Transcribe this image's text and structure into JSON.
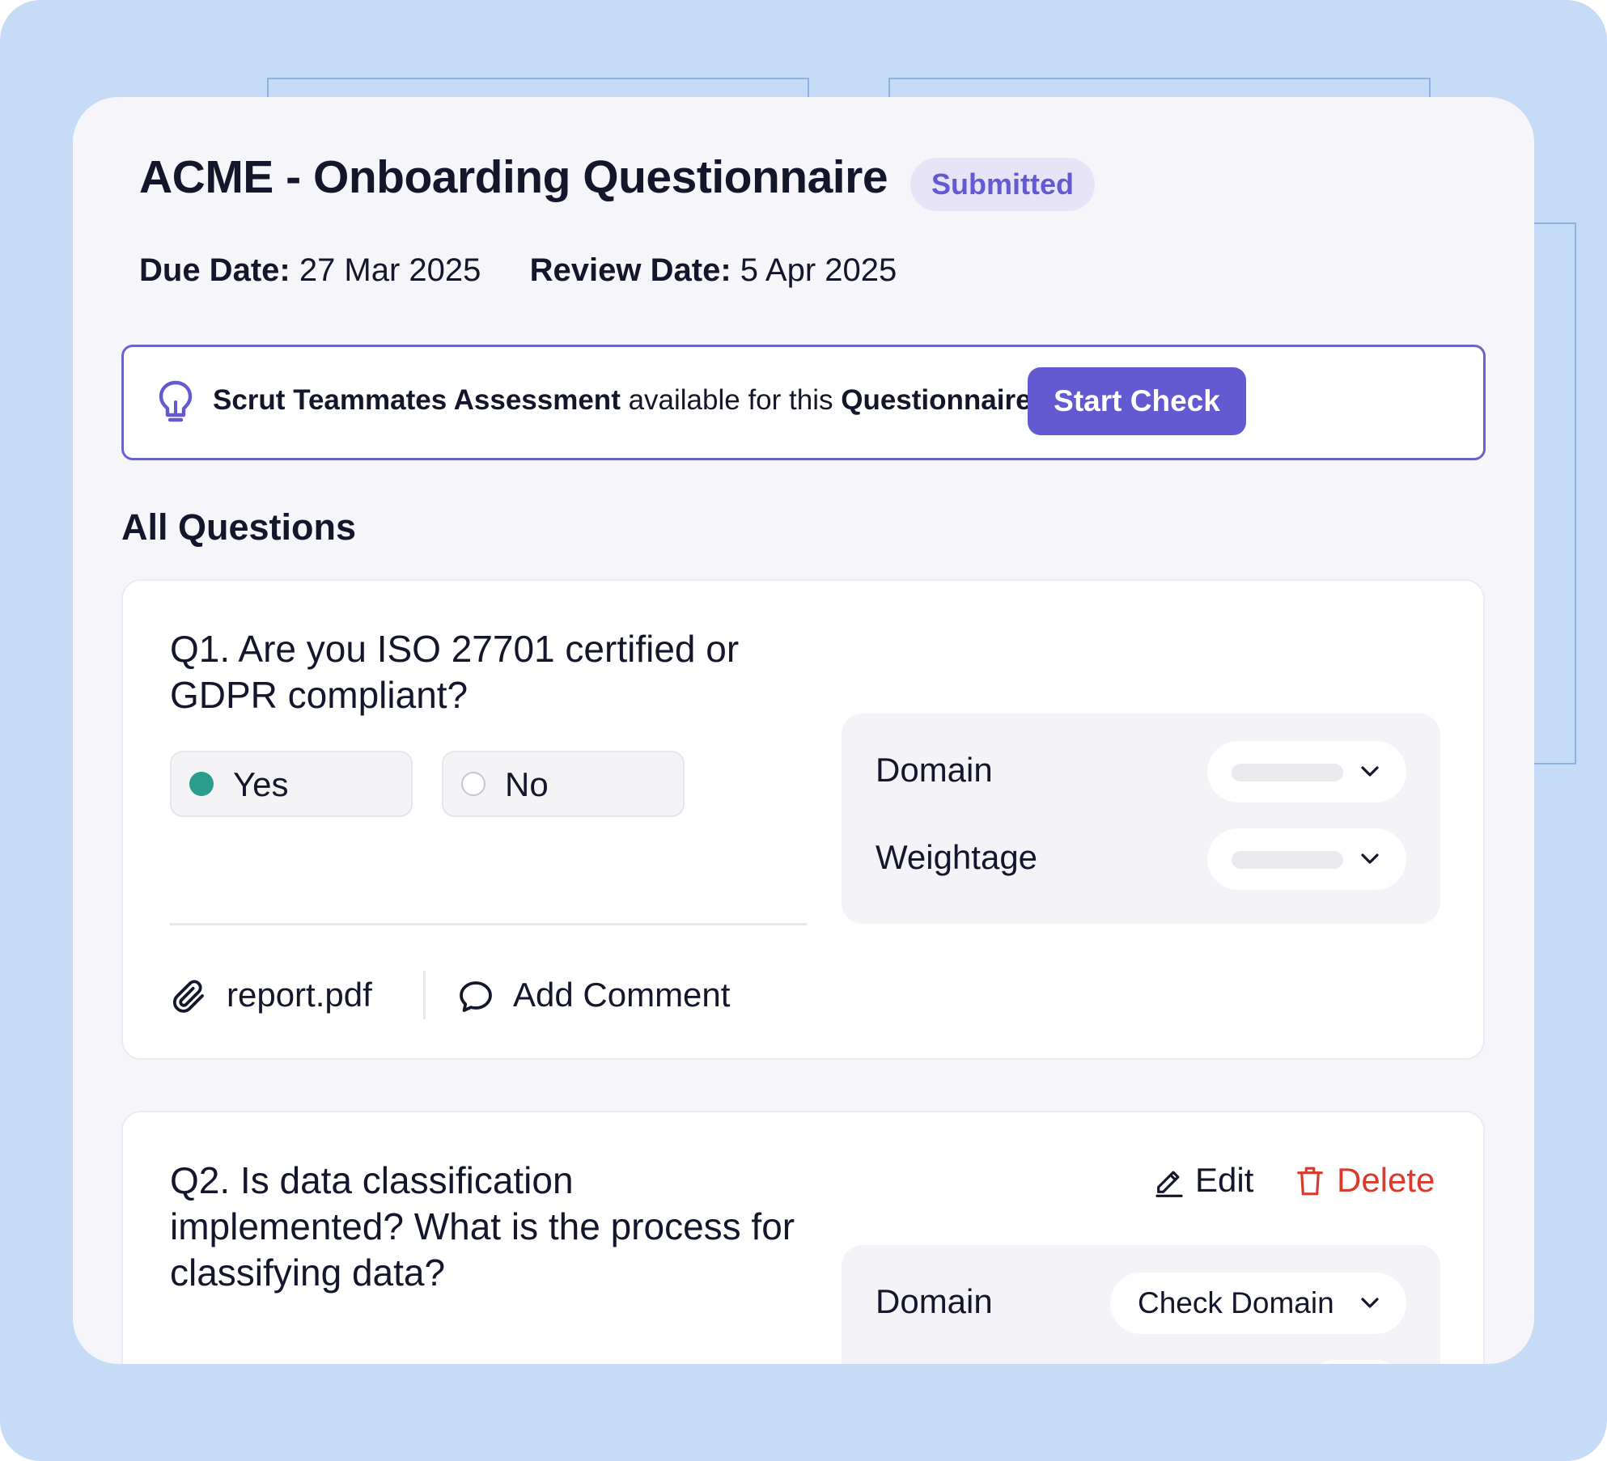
{
  "header": {
    "title": "ACME - Onboarding Questionnaire",
    "status": "Submitted",
    "due_label": "Due Date:",
    "due_value": "27 Mar 2025",
    "review_label": "Review Date:",
    "review_value": "5 Apr 2025"
  },
  "banner": {
    "icon": "lightbulb-icon",
    "strong1": "Scrut Teammates Assessment",
    "middle": " available for this ",
    "strong2": "Questionnaire Response",
    "button_label": "Start Check"
  },
  "section_title": "All Questions",
  "questions": [
    {
      "text": "Q1. Are you ISO 27701 certified or GDPR compliant?",
      "options": [
        {
          "label": "Yes",
          "selected": true
        },
        {
          "label": "No",
          "selected": false
        }
      ],
      "attachment": "report.pdf",
      "comment_label": "Add Comment",
      "domain_label": "Domain",
      "weightage_label": "Weightage"
    },
    {
      "text": "Q2. Is data classification implemented? What is the process for classifying data?",
      "edit_label": "Edit",
      "delete_label": "Delete",
      "domain_label": "Domain",
      "domain_value": "Check Domain"
    }
  ],
  "colors": {
    "accent": "#6359d1",
    "selected": "#2a9d8f",
    "danger": "#d93a2b",
    "background": "#c6dcf6"
  }
}
